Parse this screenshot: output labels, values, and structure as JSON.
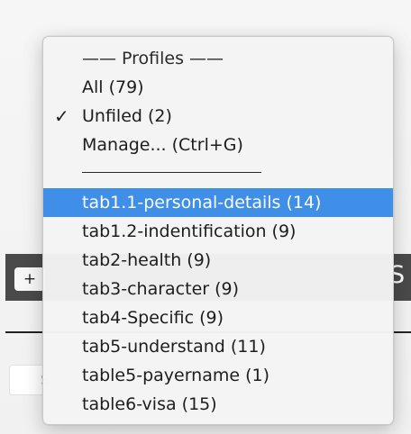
{
  "background": {
    "add_button_label": "+",
    "trailing_text": "S",
    "field_text": "S"
  },
  "menu": {
    "header_label": "—— Profiles ——",
    "items": [
      {
        "label": "All (79)",
        "checked": false
      },
      {
        "label": "Unfiled (2)",
        "checked": true
      },
      {
        "label": "Manage... (Ctrl+G)",
        "checked": false
      }
    ],
    "checkmark": "✓",
    "profiles": [
      {
        "label": "tab1.1-personal-details (14)",
        "highlighted": true
      },
      {
        "label": "tab1.2-indentification (9)",
        "highlighted": false
      },
      {
        "label": "tab2-health (9)",
        "highlighted": false
      },
      {
        "label": "tab3-character (9)",
        "highlighted": false
      },
      {
        "label": "tab4-Specific (9)",
        "highlighted": false
      },
      {
        "label": "tab5-understand (11)",
        "highlighted": false
      },
      {
        "label": "table5-payername (1)",
        "highlighted": false
      },
      {
        "label": "table6-visa (15)",
        "highlighted": false
      }
    ]
  },
  "colors": {
    "highlight": "#3f8ee8",
    "menu_background": "#f4f4f4",
    "toolbar_dark": "#4a4a4a"
  }
}
